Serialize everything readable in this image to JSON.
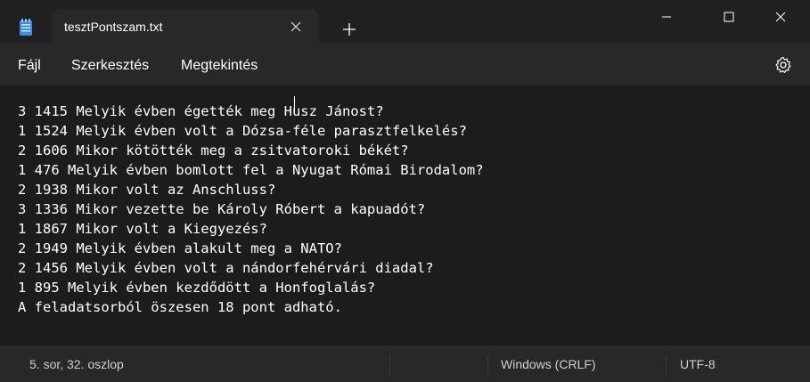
{
  "window": {
    "tab_title": "tesztPontszam.txt",
    "close_tab_glyph": "✕",
    "new_tab_glyph": "+",
    "app_icon": "notepad-icon",
    "controls": [
      "minimize-icon",
      "maximize-icon",
      "close-icon"
    ]
  },
  "menu": {
    "items": [
      "Fájl",
      "Szerkesztés",
      "Megtekintés"
    ],
    "settings_icon": "gear-icon"
  },
  "editor": {
    "lines": [
      "3 1415 Melyik évben égették meg Husz Jánost?",
      "1 1524 Melyik évben volt a Dózsa-féle parasztfelkelés?",
      "2 1606 Mikor kötötték meg a zsitvatoroki békét?",
      "1 476 Melyik évben bomlott fel a Nyugat Római Birodalom?",
      "2 1938 Mikor volt az Anschluss?",
      "3 1336 Mikor vezette be Károly Róbert a kapuadót?",
      "1 1867 Mikor volt a Kiegyezés?",
      "2 1949 Melyik évben alakult meg a NATO?",
      "2 1456 Melyik évben volt a nándorfehérvári diadal?",
      "1 895 Melyik évben kezdődött a Honfoglalás?",
      "A feladatsorból öszesen 18 pont adható."
    ]
  },
  "status": {
    "position": "5. sor, 32. oszlop",
    "line_ending": "Windows (CRLF)",
    "encoding": "UTF-8"
  },
  "colors": {
    "background": "#1c1c1c",
    "chrome": "#282828",
    "titlebar": "#202020",
    "text": "#ffffff"
  }
}
